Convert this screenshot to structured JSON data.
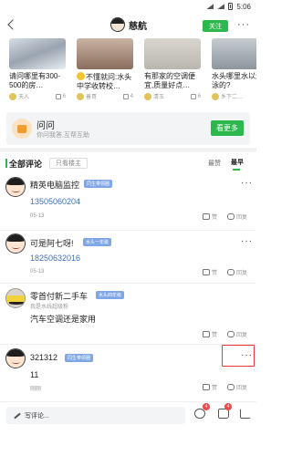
{
  "status": {
    "time": "5:06"
  },
  "header": {
    "title": "慈航",
    "follow_label": "关注"
  },
  "cards": [
    {
      "title": "请问哪里有300-500的房…",
      "author": "天人",
      "likes": "6"
    },
    {
      "title": "不懂就问:水头中学收转校…",
      "author": "善哥",
      "likes": "4"
    },
    {
      "title": "有那家的空调便宜,质量好点…",
      "author": "清玉",
      "likes": "6"
    },
    {
      "title": "水头哪里水以游泳的?",
      "author": "乡下二…",
      "likes": ""
    }
  ],
  "ask": {
    "title": "问问",
    "subtitle": "你问我答,互帮互助",
    "button": "看更多"
  },
  "comments_header": {
    "title": "全部评论",
    "owner_only": "只看楼主",
    "sort_hot": "最赞",
    "sort_new": "最早"
  },
  "comments": [
    {
      "name": "精英电脑监控",
      "badge": "同生带领圈",
      "text": "13505060204",
      "sub": "",
      "date": "05-13",
      "like_label": "赞",
      "reply_label": "回复"
    },
    {
      "name": "可是阿七呀!",
      "badge": "水头一年级",
      "text": "18250632016",
      "sub": "",
      "date": "05-13",
      "like_label": "赞",
      "reply_label": "回复"
    },
    {
      "name": "零首付新二手车",
      "badge": "水头四年级",
      "text": "汽车空调还是家用",
      "sub": "我是水线超级粉",
      "date": "05-13",
      "like_label": "赞",
      "reply_label": "回复"
    },
    {
      "name": "321312",
      "badge": "同生带领圈",
      "text": "11",
      "sub": "",
      "date": "刚刚",
      "like_label": "赞",
      "reply_label": "回复"
    }
  ],
  "bottom": {
    "write_placeholder": "写评论...",
    "comment_count": "4",
    "like_count": "4"
  },
  "colors": {
    "brand_green": "#2db84d",
    "highlight_red": "#e53935",
    "link_blue": "#3f6fb6"
  }
}
